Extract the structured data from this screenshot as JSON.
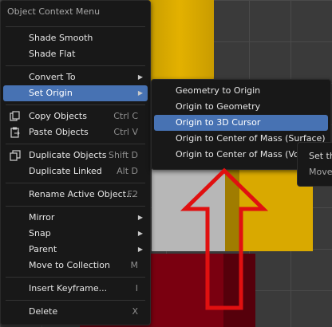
{
  "colors": {
    "highlight": "#4772b3",
    "menu_bg": "#181818",
    "arrow": "#e01010"
  },
  "menu": {
    "title": "Object Context Menu",
    "items": [
      {
        "label": "Shade Smooth",
        "shortcut": "",
        "submenu": false,
        "icon": ""
      },
      {
        "label": "Shade Flat",
        "shortcut": "",
        "submenu": false,
        "icon": ""
      },
      {
        "label": "Convert To",
        "shortcut": "",
        "submenu": true,
        "icon": ""
      },
      {
        "label": "Set Origin",
        "shortcut": "",
        "submenu": true,
        "icon": ""
      },
      {
        "label": "Copy Objects",
        "shortcut": "Ctrl C",
        "submenu": false,
        "icon": "copy-icon"
      },
      {
        "label": "Paste Objects",
        "shortcut": "Ctrl V",
        "submenu": false,
        "icon": "paste-icon"
      },
      {
        "label": "Duplicate Objects",
        "shortcut": "Shift D",
        "submenu": false,
        "icon": "duplicate-icon"
      },
      {
        "label": "Duplicate Linked",
        "shortcut": "Alt D",
        "submenu": false,
        "icon": ""
      },
      {
        "label": "Rename Active Object...",
        "shortcut": "F2",
        "submenu": false,
        "icon": ""
      },
      {
        "label": "Mirror",
        "shortcut": "",
        "submenu": true,
        "icon": ""
      },
      {
        "label": "Snap",
        "shortcut": "",
        "submenu": true,
        "icon": ""
      },
      {
        "label": "Parent",
        "shortcut": "",
        "submenu": true,
        "icon": ""
      },
      {
        "label": "Move to Collection",
        "shortcut": "M",
        "submenu": false,
        "icon": ""
      },
      {
        "label": "Insert Keyframe...",
        "shortcut": "I",
        "submenu": false,
        "icon": ""
      },
      {
        "label": "Delete",
        "shortcut": "X",
        "submenu": false,
        "icon": ""
      }
    ]
  },
  "submenu": {
    "items": [
      {
        "label": "Geometry to Origin"
      },
      {
        "label": "Origin to Geometry"
      },
      {
        "label": "Origin to 3D Cursor"
      },
      {
        "label": "Origin to Center of Mass (Surface)"
      },
      {
        "label": "Origin to Center of Mass (Volume)"
      }
    ]
  },
  "tooltip": {
    "line1": "Set th",
    "line2": "Move"
  }
}
